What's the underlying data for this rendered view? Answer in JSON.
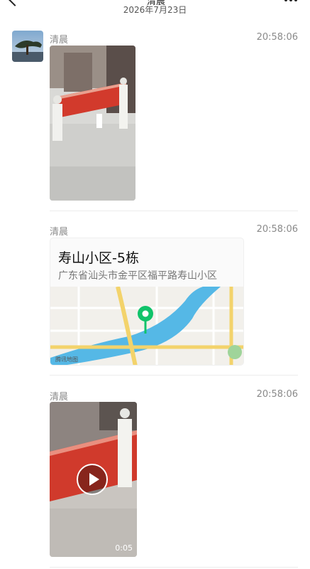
{
  "header": {
    "title": "清晨",
    "date": "2026年7月23日",
    "more_icon": "more-dots-icon",
    "back_icon": "chevron-left-icon"
  },
  "messages": [
    {
      "sender": "清晨",
      "time": "20:58:06",
      "type": "image"
    },
    {
      "sender": "清晨",
      "time": "20:58:06",
      "type": "location",
      "location": {
        "name": "寿山小区-5栋",
        "address": "广东省汕头市金平区福平路寿山小区",
        "map_credit": "腾讯地图"
      }
    },
    {
      "sender": "清晨",
      "time": "20:58:06",
      "type": "video",
      "duration": "0:05"
    }
  ],
  "colors": {
    "accent_pin": "#10c36a",
    "river": "#55b8e6",
    "road_yellow": "#f3d36b"
  }
}
